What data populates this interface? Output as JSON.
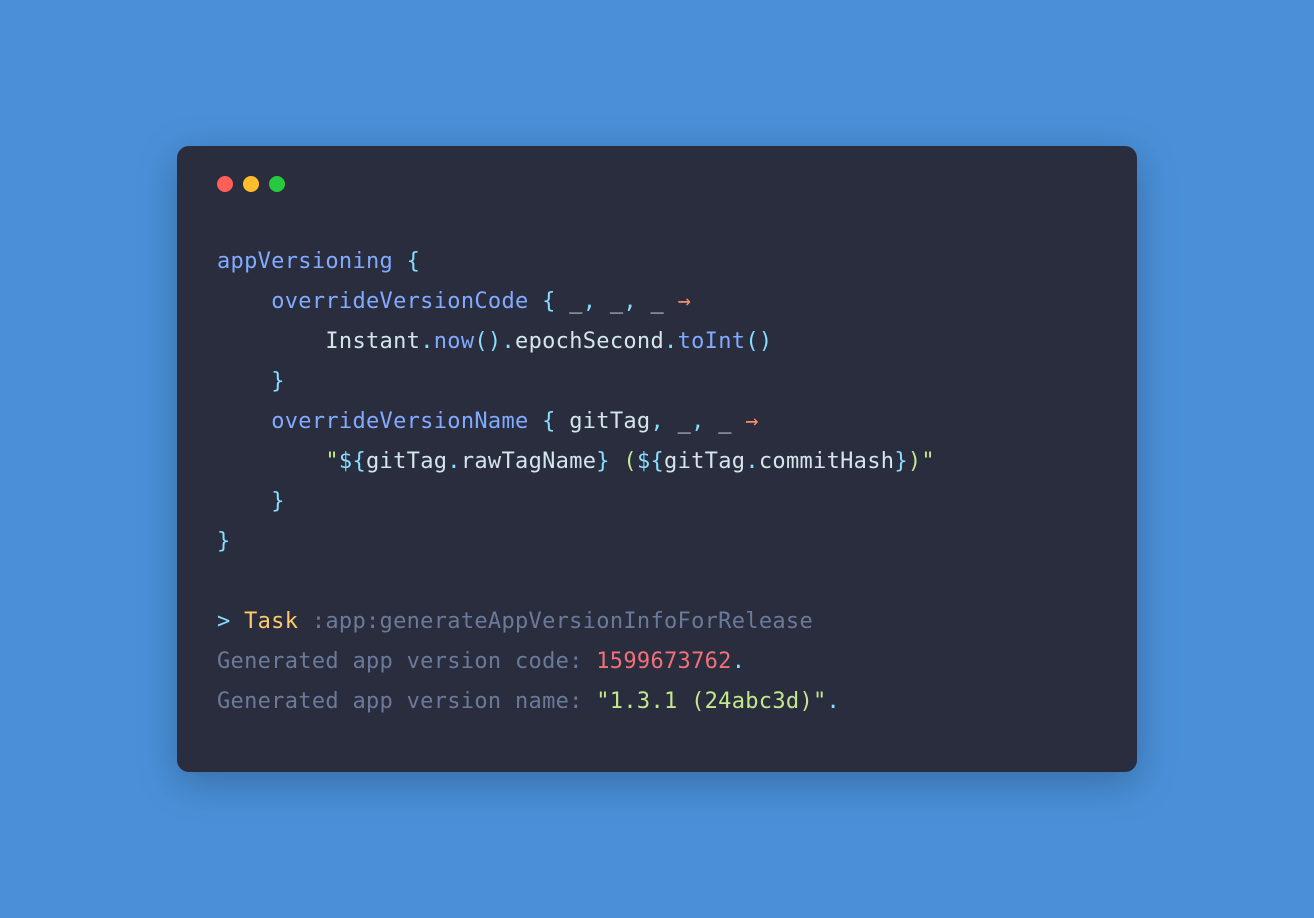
{
  "code": {
    "l1": {
      "fn": "appVersioning",
      "brace": " {"
    },
    "l2": {
      "indent": "    ",
      "fn": "overrideVersionCode",
      "mid": " { ",
      "u1": "_",
      "c1": ", ",
      "u2": "_",
      "c2": ", ",
      "u3": "_",
      "sp": " ",
      "arrow": "→"
    },
    "l3": {
      "indent": "        ",
      "class": "Instant",
      "dot1": ".",
      "m1": "now",
      "p1": "()",
      "dot2": ".",
      "prop1": "epochSecond",
      "dot3": ".",
      "m2": "toInt",
      "p2": "()"
    },
    "l4": {
      "indent": "    ",
      "brace": "}"
    },
    "l5": {
      "indent": "    ",
      "fn": "overrideVersionName",
      "mid": " { ",
      "p1": "gitTag",
      "c1": ", ",
      "u1": "_",
      "c2": ", ",
      "u2": "_",
      "sp": " ",
      "arrow": "→"
    },
    "l6": {
      "indent": "        ",
      "q1": "\"",
      "d1": "${",
      "g1": "gitTag",
      "dot1": ".",
      "prop1": "rawTagName",
      "cb1": "}",
      "mid": " (",
      "d2": "${",
      "g2": "gitTag",
      "dot2": ".",
      "prop2": "commitHash",
      "cb2": "}",
      "end": ")",
      "q2": "\""
    },
    "l7": {
      "indent": "    ",
      "brace": "}"
    },
    "l8": {
      "brace": "}"
    }
  },
  "output": {
    "l1": {
      "prompt": "> ",
      "task": "Task",
      "name": " :app:generateAppVersionInfoForRelease"
    },
    "l2": {
      "label": "Generated app version code: ",
      "value": "1599673762",
      "end": "."
    },
    "l3": {
      "label": "Generated app version name: ",
      "value": "\"1.3.1 (24abc3d)\"",
      "end": "."
    }
  }
}
